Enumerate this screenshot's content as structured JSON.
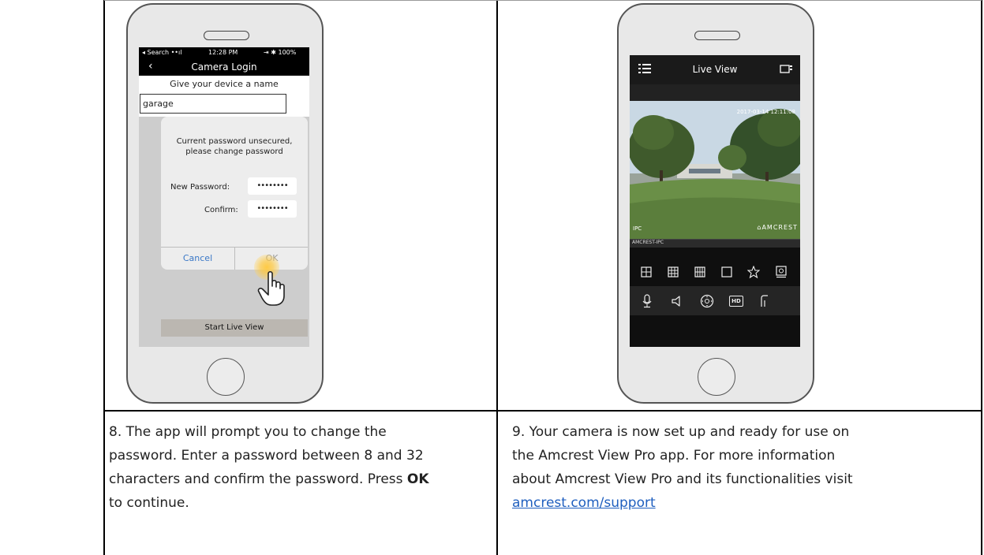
{
  "step8": {
    "text_1": "8. The app will prompt you to change the password. Enter a password between 8 and 32 characters and confirm the password. Press ",
    "bold": "OK",
    "text_2": " to continue."
  },
  "step9": {
    "text_1": "9. Your camera is now set up and ready for use on the Amcrest View Pro app.  For more information about Amcrest View Pro and its functionalities visit ",
    "link": "amcrest.com/support"
  },
  "left_phone": {
    "status_carrier": "◂ Search ••ıl",
    "status_time": "12:28 PM",
    "status_battery": "⇥ ✱ 100%",
    "nav_title": "Camera Login",
    "back": "‹",
    "name_prompt": "Give your device a name",
    "device_name": "garage",
    "dialog_message_1": "Current password unsecured,",
    "dialog_message_2": "please change password",
    "new_password_label": "New Password:",
    "new_password_value": "••••••••",
    "confirm_label": "Confirm:",
    "confirm_value": "••••••••",
    "cancel": "Cancel",
    "ok": "OK",
    "start_live_view": "Start Live View"
  },
  "right_phone": {
    "title": "Live View",
    "timestamp": "2017-03-14 12:11:08",
    "overlay_left": "IPC",
    "brand": "⌂AMCREST",
    "camera_name": "AMCREST-IPC",
    "toolbar_icons": [
      "grid-4-icon",
      "grid-9-icon",
      "grid-16-icon",
      "single-view-icon",
      "favorite-star-icon",
      "snapshot-icon"
    ],
    "control_icons": [
      "microphone-icon",
      "speaker-icon",
      "ptz-icon",
      "hd-icon",
      "more-icon"
    ],
    "hd_label": "HD"
  },
  "colors": {
    "link": "#1f5fbf",
    "dialog_button": "#3a78c7"
  }
}
